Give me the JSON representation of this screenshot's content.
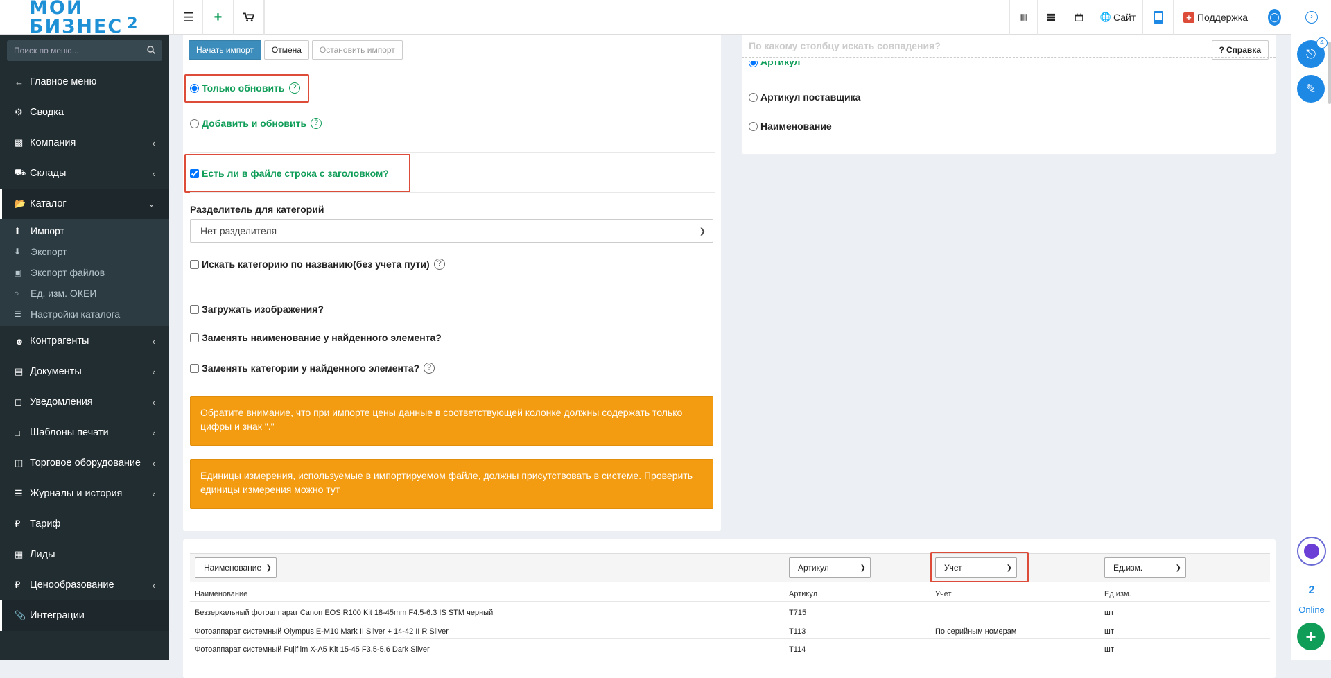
{
  "header": {
    "logo_text_1": "МОЙ",
    "logo_text_2": "БИЗНЕС",
    "logo_text_3": "2",
    "site_label": "Сайт",
    "support_label": "Поддержка"
  },
  "sidebar": {
    "search_placeholder": "Поиск по меню...",
    "items": [
      {
        "label": "Главное меню",
        "icon": "arrow-left-icon"
      },
      {
        "label": "Сводка",
        "icon": "gear-icon"
      },
      {
        "label": "Компания",
        "icon": "bar-chart-icon"
      },
      {
        "label": "Склады",
        "icon": "truck-icon"
      },
      {
        "label": "Каталог",
        "icon": "folder-open-icon"
      },
      {
        "label": "Контрагенты",
        "icon": "users-icon"
      },
      {
        "label": "Документы",
        "icon": "document-icon"
      },
      {
        "label": "Уведомления",
        "icon": "chat-icon"
      },
      {
        "label": "Шаблоны печати",
        "icon": "file-icon"
      },
      {
        "label": "Торговое оборудование",
        "icon": "inbox-icon"
      },
      {
        "label": "Журналы и история",
        "icon": "list-icon"
      },
      {
        "label": "Тариф",
        "icon": "ruble-icon"
      },
      {
        "label": "Лиды",
        "icon": "contact-icon"
      },
      {
        "label": "Ценообразование",
        "icon": "ruble-icon"
      },
      {
        "label": "Интеграции",
        "icon": "paperclip-icon"
      }
    ],
    "catalog_sub": [
      {
        "label": "Импорт"
      },
      {
        "label": "Экспорт"
      },
      {
        "label": "Экспорт файлов"
      },
      {
        "label": "Ед. изм. ОКЕИ"
      },
      {
        "label": "Настройки каталога"
      }
    ]
  },
  "import": {
    "start_button": "Начать импорт",
    "cancel_button": "Отмена",
    "stop_button": "Остановить импорт",
    "help_button": "Справка",
    "only_update": "Только обновить",
    "add_and_update": "Добавить и обновить",
    "has_header_row": "Есть ли в файле строка с заголовком?",
    "category_separator_label": "Разделитель для категорий",
    "category_separator_value": "Нет разделителя",
    "search_category_by_name": "Искать категорию по названию(без учета пути)",
    "load_images": "Загружать изображения?",
    "replace_name": "Заменять наименование у найденного элемента?",
    "replace_categories": "Заменять категории у найденного элемента?",
    "alert_price": "Обратите внимание, что при импорте цены данные в соответствующей колонке должны содержать только цифры и знак \".\"",
    "alert_units_text": "Единицы измерения, используемые в импортируемом файле, должны присутствовать в системе. Проверить единицы измерения можно ",
    "alert_units_link": "тут"
  },
  "match": {
    "title": "По какому столбцу искать совпадения?",
    "option_article": "Артикул",
    "option_supplier_article": "Артикул поставщика",
    "option_name": "Наименование"
  },
  "table": {
    "selects": [
      "Наименование",
      "Артикул",
      "Учет",
      "Ед.изм."
    ],
    "headers": [
      "Наименование",
      "Артикул",
      "Учет",
      "Ед.изм."
    ],
    "rows": [
      [
        "Беззеркальный фотоаппарат Canon EOS R100 Kit 18-45mm F4.5-6.3 IS STM черный",
        "T715",
        "",
        "шт"
      ],
      [
        "Фотоаппарат системный Olympus E-M10 Mark II Silver + 14-42 II R Silver",
        "T113",
        "По серийным номерам",
        "шт"
      ],
      [
        "Фотоаппарат системный Fujifilm X-A5 Kit 15-45 F3.5-5.6 Dark Silver",
        "T114",
        "",
        "шт"
      ]
    ]
  },
  "rightbar": {
    "notification_count": "4",
    "online_count": "2",
    "online_label": "Online"
  },
  "colors": {
    "sidebar_bg": "#222d32",
    "primary": "#3c8dbc",
    "accent_green": "#0f9d58",
    "warning": "#f39c12",
    "highlight": "#dd4b39"
  }
}
